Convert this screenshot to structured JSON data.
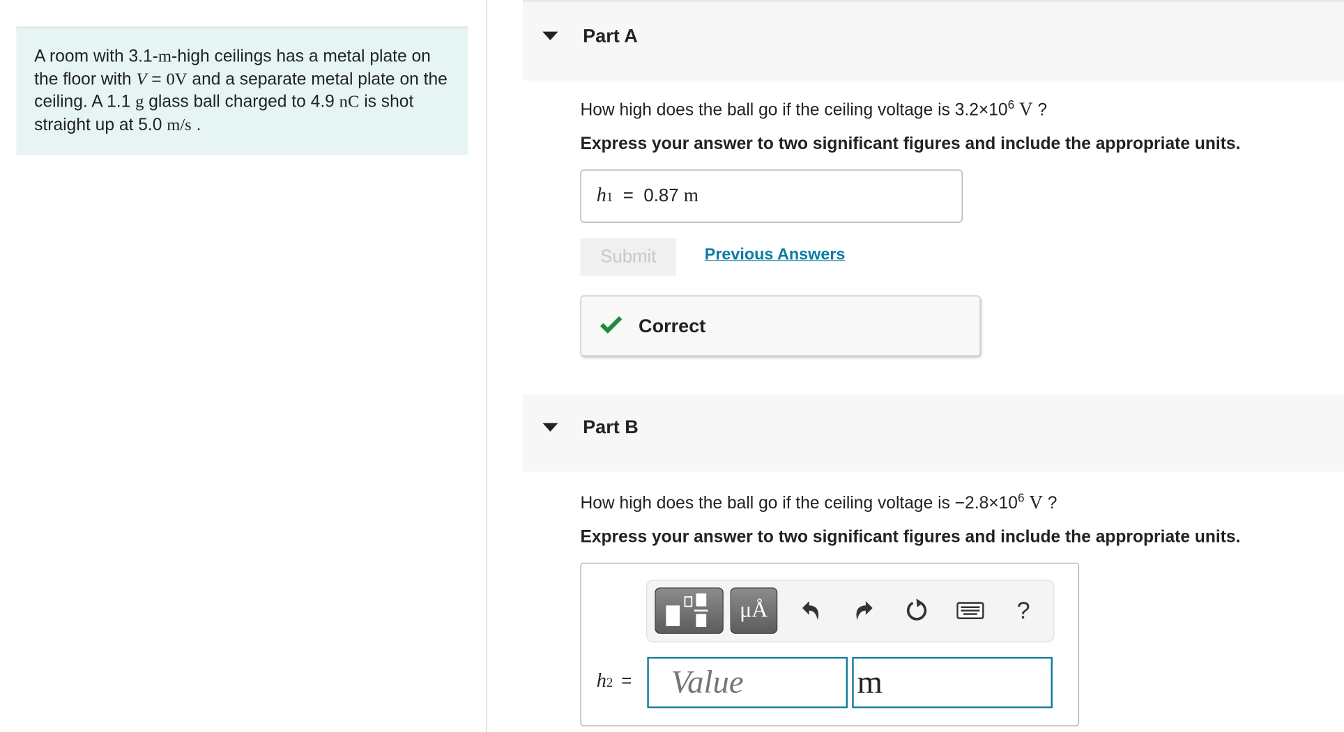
{
  "problem": {
    "t1": "A room with 3.1-",
    "u_m": "m",
    "t2": "-high ceilings has a metal plate on the floor with ",
    "v_sym": "V",
    "eq": " = ",
    "v_val": "0V",
    "t3": " and a separate metal plate on the ceiling. A 1.1 ",
    "u_g": "g",
    "t4": " glass ball charged to 4.9 ",
    "u_nC": "nC",
    "t5": " is shot straight up at 5.0 ",
    "u_ms": "m/s",
    "t6": " ."
  },
  "part_a": {
    "title": "Part A",
    "question_pre": "How high does the ball go if the ceiling voltage is 3.2×10",
    "question_exp": "6",
    "question_unit": "V",
    "question_post": " ?",
    "instruction": "Express your answer to two significant figures and include the appropriate units.",
    "answer_var": "h",
    "answer_sub": "1",
    "answer_eq": "=",
    "answer_value": "0.87",
    "answer_unit": "m",
    "submit_label": "Submit",
    "previous_answers_label": "Previous Answers",
    "feedback": "Correct",
    "feedback_color": "#1f8a3b"
  },
  "part_b": {
    "title": "Part B",
    "question_pre": "How high does the ball go if the ceiling voltage is −2.8×10",
    "question_exp": "6",
    "question_unit": "V",
    "question_post": " ?",
    "instruction": "Express your answer to two significant figures and include the appropriate units.",
    "answer_var": "h",
    "answer_sub": "2",
    "answer_eq": "=",
    "value_placeholder": "Value",
    "unit_value": "m",
    "toolbar": {
      "units_label": "μÅ",
      "help_label": "?",
      "icons": [
        "templates-icon",
        "units-icon",
        "undo-icon",
        "redo-icon",
        "reset-icon",
        "keyboard-icon",
        "help-icon"
      ]
    },
    "input_border_color": "#137c98"
  }
}
